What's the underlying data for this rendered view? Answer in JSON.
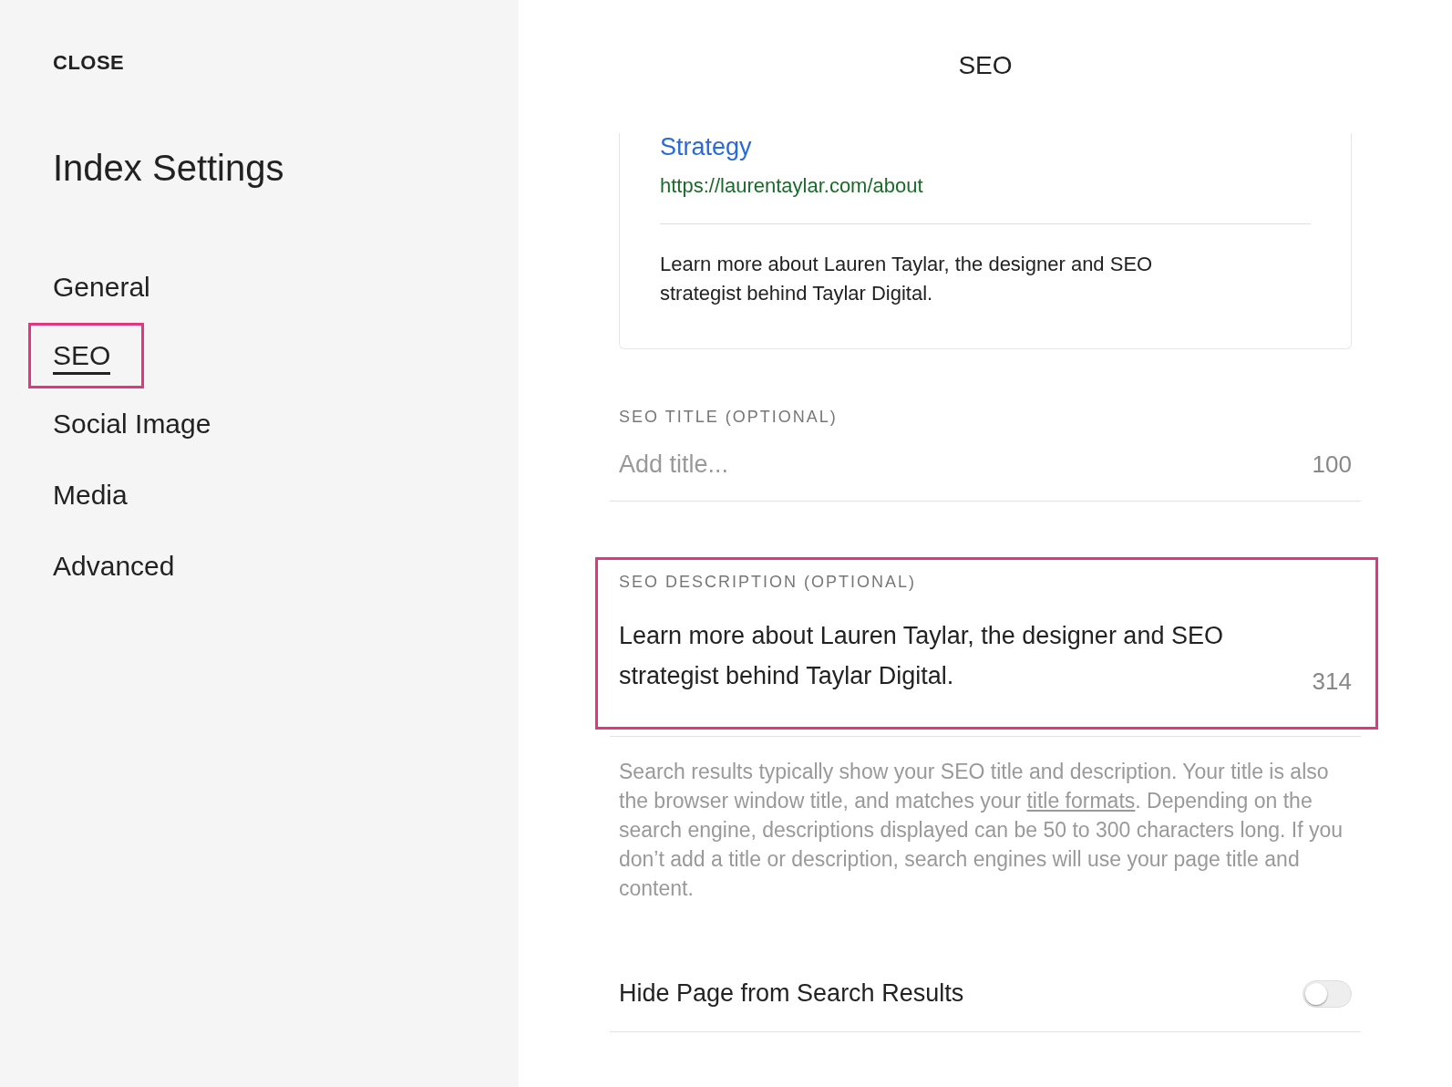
{
  "sidebar": {
    "close": "CLOSE",
    "title": "Index Settings",
    "items": [
      {
        "label": "General",
        "selected": false,
        "highlighted": false
      },
      {
        "label": "SEO",
        "selected": true,
        "highlighted": true
      },
      {
        "label": "Social Image",
        "selected": false,
        "highlighted": false
      },
      {
        "label": "Media",
        "selected": false,
        "highlighted": false
      },
      {
        "label": "Advanced",
        "selected": false,
        "highlighted": false
      }
    ]
  },
  "panel": {
    "title": "SEO",
    "preview": {
      "title": "Strategy",
      "url": "https://laurentaylar.com/about",
      "description": "Learn more about Lauren Taylar, the designer and SEO strategist behind Taylar Digital."
    },
    "fields": [
      {
        "label": "SEO TITLE (OPTIONAL)",
        "placeholder": "Add title...",
        "counter": "100",
        "highlighted": false
      },
      {
        "label": "SEO DESCRIPTION (OPTIONAL)",
        "value": "Learn more about Lauren Taylar, the designer and SEO strategist behind Taylar Digital.",
        "counter": "314",
        "highlighted": true
      }
    ],
    "help": {
      "before": "Search results typically show your SEO title and description. Your title is also the browser window title, and matches your ",
      "link": "title formats",
      "after": ". Depending on the search engine, descriptions displayed can be 50 to 300 characters long. If you don’t add a title or description, search engines will use your page title and content."
    },
    "toggle": {
      "label": "Hide Page from Search Results",
      "on": false
    }
  }
}
